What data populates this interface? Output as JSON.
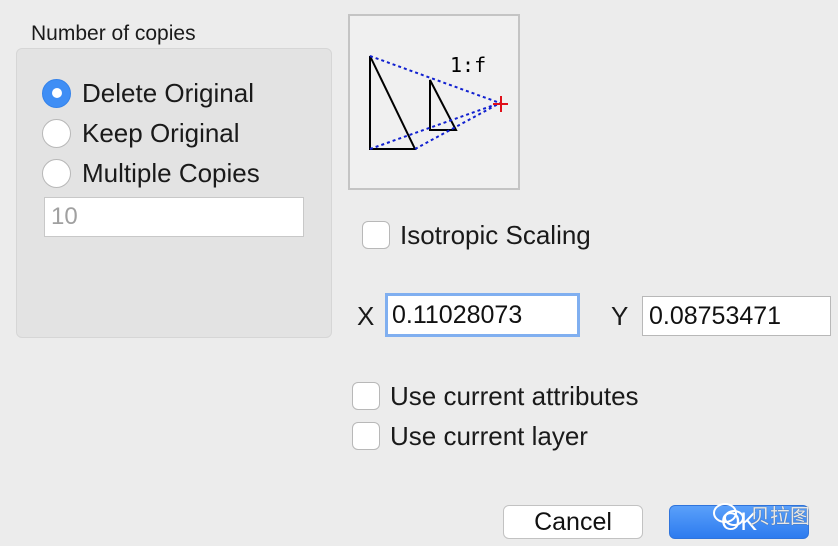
{
  "copies": {
    "title": "Number of copies",
    "options": [
      {
        "label": "Delete Original",
        "selected": true
      },
      {
        "label": "Keep Original",
        "selected": false
      },
      {
        "label": "Multiple Copies",
        "selected": false
      }
    ],
    "count_value": "10"
  },
  "preview": {
    "ratio_label": "1:f",
    "icon": "scale-preview-icon"
  },
  "isotropic": {
    "label": "Isotropic Scaling",
    "checked": false
  },
  "scale": {
    "x_label": "X",
    "x_value": "0.11028073",
    "y_label": "Y",
    "y_value": "0.08753471"
  },
  "options": {
    "use_attributes": {
      "label": "Use current attributes",
      "checked": false
    },
    "use_layer": {
      "label": "Use current layer",
      "checked": false
    }
  },
  "buttons": {
    "cancel": "Cancel",
    "ok": "OK"
  },
  "watermark": {
    "text": "贝拉图"
  },
  "colors": {
    "accent": "#3f8ef5",
    "background": "#ececec",
    "preview_dashes": "#1020d0",
    "preview_marker": "#e0101a"
  }
}
